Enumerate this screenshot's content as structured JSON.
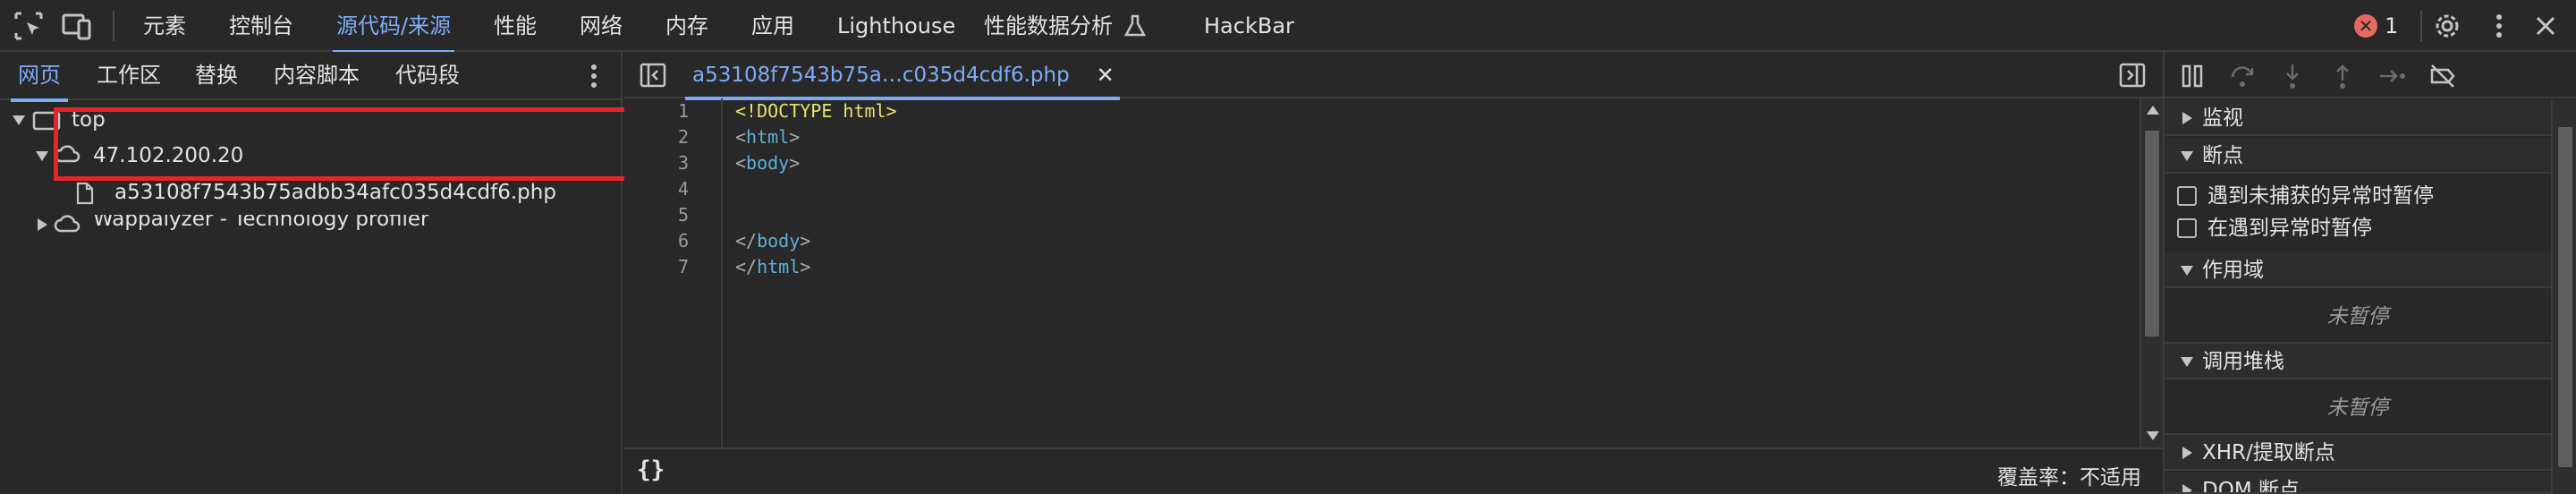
{
  "toolbar": {
    "tabs": [
      {
        "label": "元素"
      },
      {
        "label": "控制台"
      },
      {
        "label": "源代码/来源"
      },
      {
        "label": "性能"
      },
      {
        "label": "网络"
      },
      {
        "label": "内存"
      },
      {
        "label": "应用"
      },
      {
        "label": "Lighthouse"
      },
      {
        "label": "性能数据分析"
      },
      {
        "label": "HackBar"
      }
    ],
    "active_tab": "源代码/来源",
    "error_count": "1"
  },
  "navigator": {
    "tabs": [
      {
        "label": "网页"
      },
      {
        "label": "工作区"
      },
      {
        "label": "替换"
      },
      {
        "label": "内容脚本"
      },
      {
        "label": "代码段"
      }
    ],
    "tree": {
      "top": "top",
      "host": "47.102.200.20",
      "file": "a53108f7543b75adbb34afc035d4cdf6.php",
      "extension": "Wappalyzer - Technology profiler"
    }
  },
  "editor": {
    "tab_label": "a53108f7543b75a…c035d4cdf6.php",
    "close_glyph": "✕",
    "lines": [
      {
        "n": "1",
        "parts": [
          {
            "t": "<!DOCTYPE html>",
            "c": "c-doc"
          }
        ]
      },
      {
        "n": "2",
        "parts": [
          {
            "t": "<",
            "c": "c-br"
          },
          {
            "t": "html",
            "c": "c-tag"
          },
          {
            "t": ">",
            "c": "c-br"
          }
        ]
      },
      {
        "n": "3",
        "parts": [
          {
            "t": "<",
            "c": "c-br"
          },
          {
            "t": "body",
            "c": "c-tag"
          },
          {
            "t": ">",
            "c": "c-br"
          }
        ]
      },
      {
        "n": "4",
        "parts": []
      },
      {
        "n": "5",
        "parts": []
      },
      {
        "n": "6",
        "parts": [
          {
            "t": "</",
            "c": "c-br"
          },
          {
            "t": "body",
            "c": "c-tag"
          },
          {
            "t": ">",
            "c": "c-br"
          }
        ]
      },
      {
        "n": "7",
        "parts": [
          {
            "t": "</",
            "c": "c-br"
          },
          {
            "t": "html",
            "c": "c-tag"
          },
          {
            "t": ">",
            "c": "c-br"
          }
        ]
      }
    ],
    "pretty_print": "{}",
    "coverage": "覆盖率：不适用"
  },
  "debugger": {
    "watch": "监视",
    "breakpoints": "断点",
    "pause_uncaught": "遇到未捕获的异常时暂停",
    "pause_caught": "在遇到异常时暂停",
    "scope": "作用域",
    "scope_empty": "未暂停",
    "call_stack": "调用堆栈",
    "call_stack_empty": "未暂停",
    "xhr_breakpoints": "XHR/提取断点",
    "dom_breakpoints": "DOM 断点"
  },
  "colors": {
    "accent": "#7cacf8",
    "error": "#e46962",
    "highlight": "#e3262b",
    "background": "#282828"
  }
}
